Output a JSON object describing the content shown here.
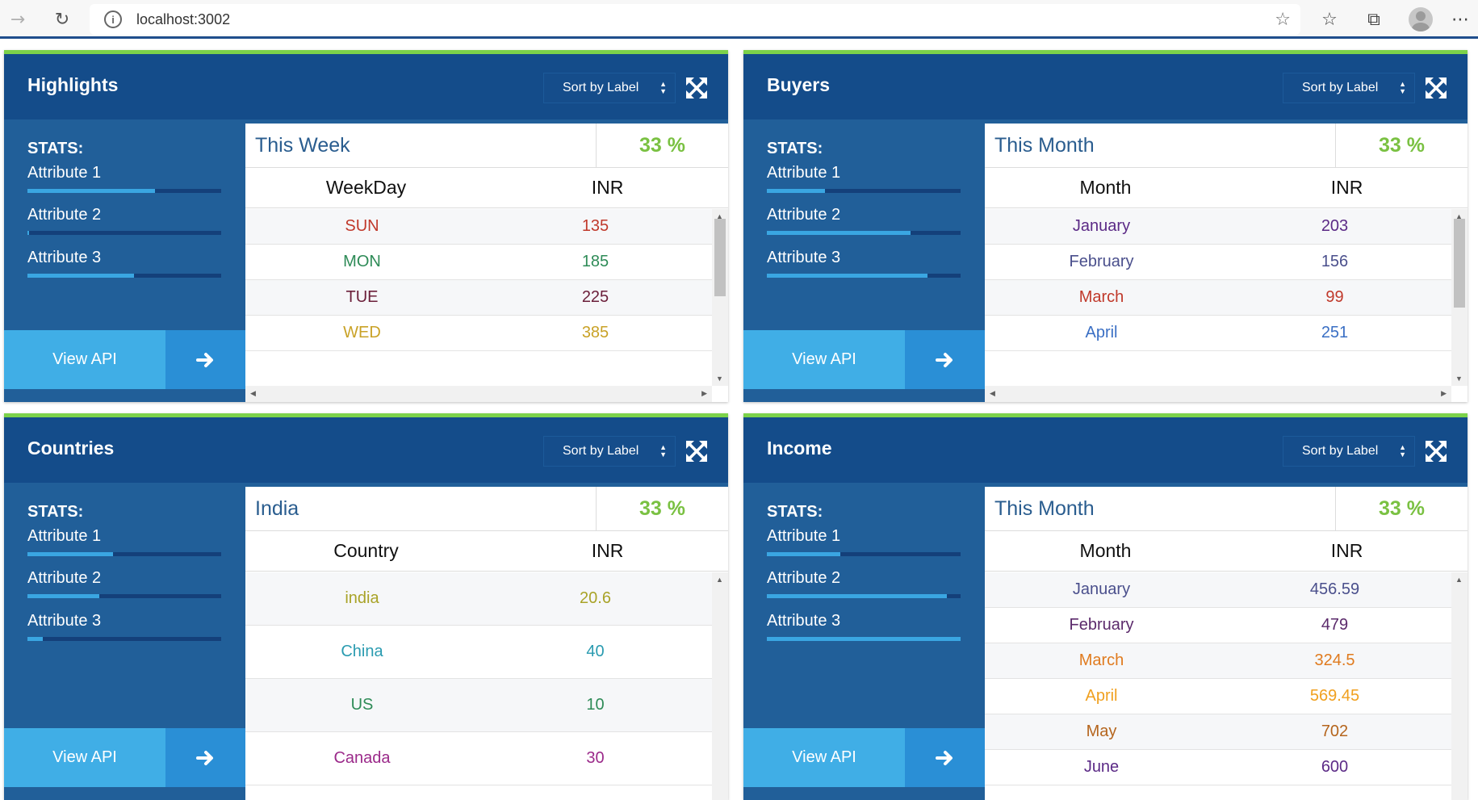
{
  "browser": {
    "url": "localhost:3002",
    "back_icon": "arrow-right-icon",
    "reload_icon": "reload-icon"
  },
  "widgets": [
    {
      "title": "Highlights",
      "sort_label": "Sort by Label",
      "stats_label": "STATS:",
      "attributes": [
        {
          "name": "Attribute 1",
          "value": 0.66
        },
        {
          "name": "Attribute 2",
          "value": 0.01
        },
        {
          "name": "Attribute 3",
          "value": 0.55
        }
      ],
      "view_api": "View API",
      "period": "This Week",
      "percent": "33 %",
      "col1": "WeekDay",
      "col2": "INR",
      "rows": [
        {
          "label": "SUN",
          "value": "135",
          "color": "#c0392b"
        },
        {
          "label": "MON",
          "value": "185",
          "color": "#2e8b57"
        },
        {
          "label": "TUE",
          "value": "225",
          "color": "#6b1f3a"
        },
        {
          "label": "WED",
          "value": "385",
          "color": "#c9a227"
        }
      ]
    },
    {
      "title": "Buyers",
      "sort_label": "Sort by Label",
      "stats_label": "STATS:",
      "attributes": [
        {
          "name": "Attribute 1",
          "value": 0.3
        },
        {
          "name": "Attribute 2",
          "value": 0.74
        },
        {
          "name": "Attribute 3",
          "value": 0.83
        }
      ],
      "view_api": "View API",
      "period": "This Month",
      "percent": "33 %",
      "col1": "Month",
      "col2": "INR",
      "rows": [
        {
          "label": "January",
          "value": "203",
          "color": "#5b2a86"
        },
        {
          "label": "February",
          "value": "156",
          "color": "#4a4f8c"
        },
        {
          "label": "March",
          "value": "99",
          "color": "#c0392b"
        },
        {
          "label": "April",
          "value": "251",
          "color": "#3a6fc4"
        }
      ]
    },
    {
      "title": "Countries",
      "sort_label": "Sort by Label",
      "stats_label": "STATS:",
      "attributes": [
        {
          "name": "Attribute 1",
          "value": 0.44
        },
        {
          "name": "Attribute 2",
          "value": 0.37
        },
        {
          "name": "Attribute 3",
          "value": 0.08
        }
      ],
      "view_api": "View API",
      "period": "India",
      "percent": "33 %",
      "col1": "Country",
      "col2": "INR",
      "rows": [
        {
          "label": "india",
          "value": "20.6",
          "color": "#a9a328"
        },
        {
          "label": "China",
          "value": "40",
          "color": "#2a9bb0"
        },
        {
          "label": "US",
          "value": "10",
          "color": "#2e8b57"
        },
        {
          "label": "Canada",
          "value": "30",
          "color": "#9b2a8a"
        }
      ]
    },
    {
      "title": "Income",
      "sort_label": "Sort by Label",
      "stats_label": "STATS:",
      "attributes": [
        {
          "name": "Attribute 1",
          "value": 0.38
        },
        {
          "name": "Attribute 2",
          "value": 0.93
        },
        {
          "name": "Attribute 3",
          "value": 1.0
        }
      ],
      "view_api": "View API",
      "period": "This Month",
      "percent": "33 %",
      "col1": "Month",
      "col2": "INR",
      "rows": [
        {
          "label": "January",
          "value": "456.59",
          "color": "#4a4f8c"
        },
        {
          "label": "February",
          "value": "479",
          "color": "#5b2a6b"
        },
        {
          "label": "March",
          "value": "324.5",
          "color": "#e07b1f"
        },
        {
          "label": "April",
          "value": "569.45",
          "color": "#f0a01f"
        },
        {
          "label": "May",
          "value": "702",
          "color": "#b5651d"
        },
        {
          "label": "June",
          "value": "600",
          "color": "#5b2a86"
        }
      ]
    }
  ],
  "colors": {
    "header": "#144c8a",
    "body": "#215f99",
    "accent": "#7cd24a",
    "bar_fill": "#3aa6e2",
    "bar_track": "#14407a",
    "percent": "#7ac142",
    "api_button": "#40aee6",
    "api_arrow": "#2a8fd6"
  }
}
